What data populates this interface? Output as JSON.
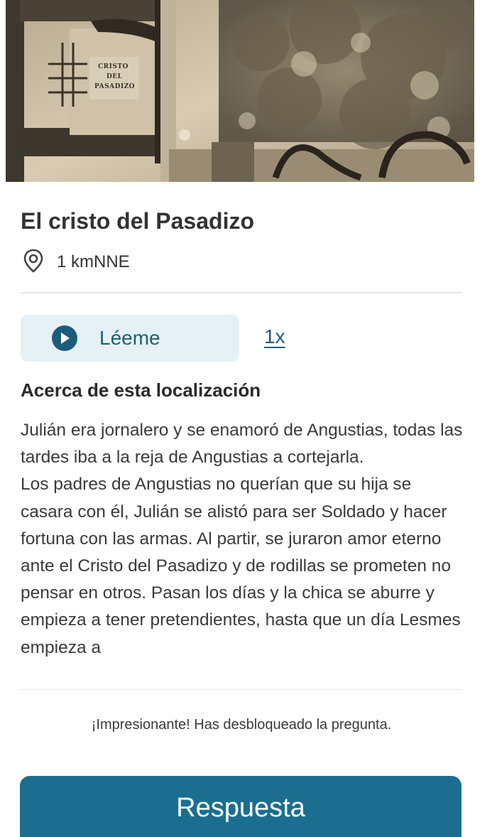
{
  "hero": {
    "sign_lines": [
      "CRISTO",
      "DEL",
      "PASADIZO"
    ],
    "icon": "photo-image"
  },
  "location": {
    "title": "El cristo del Pasadizo",
    "distance": "1 kmNNE",
    "distance_icon": "location-pin-icon"
  },
  "audio": {
    "read_label": "Léeme",
    "speed_label": "1x",
    "play_icon": "play-icon",
    "accent_color": "#1a5d7a",
    "button_bg": "#e5f1f4"
  },
  "about": {
    "heading": "Acerca de esta localización",
    "paragraphs": [
      "Julián era jornalero y se enamoró de Angustias, todas las tardes iba a la reja de Angustias a cortejarla.",
      "Los padres de Angustias no querían que su hija se casara con él, Julián se alistó para ser Soldado y hacer fortuna con las armas. Al partir, se juraron amor eterno ante el Cristo del Pasadizo y de rodillas se prometen no pensar en otros. Pasan los días y la chica se aburre y empieza a tener pretendientes, hasta que un día Lesmes empieza a"
    ]
  },
  "unlock": {
    "message": "¡Impresionante! Has desbloqueado la pregunta."
  },
  "answer": {
    "button_label": "Respuesta",
    "button_color": "#1b6e90"
  }
}
